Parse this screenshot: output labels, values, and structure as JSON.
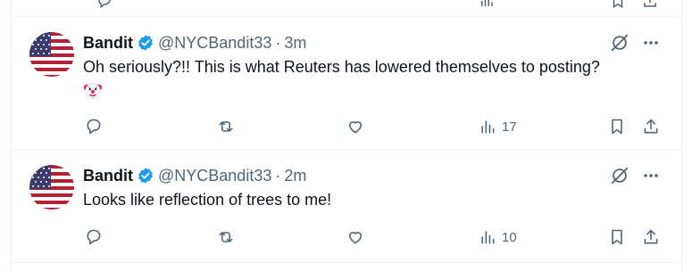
{
  "tweets": [
    {
      "name": "Bandit",
      "handle": "@NYCBandit33",
      "dot": "·",
      "time": "3m",
      "text": "Oh seriously?!!  This is what Reuters has lowered themselves to posting?",
      "emoji": "🤡",
      "views": "17"
    },
    {
      "name": "Bandit",
      "handle": "@NYCBandit33",
      "dot": "·",
      "time": "2m",
      "text": "Looks like reflection of trees to me!",
      "views": "10"
    }
  ],
  "icons": {
    "verified": "verified-badge-icon",
    "grok": "grok-icon",
    "more": "more-icon",
    "reply": "reply-icon",
    "retweet": "retweet-icon",
    "like": "like-icon",
    "views": "views-icon",
    "bookmark": "bookmark-icon",
    "share": "share-icon"
  },
  "colors": {
    "verified": "#1d9bf0",
    "secondary_text": "#536471",
    "divider": "#eff3f4"
  }
}
